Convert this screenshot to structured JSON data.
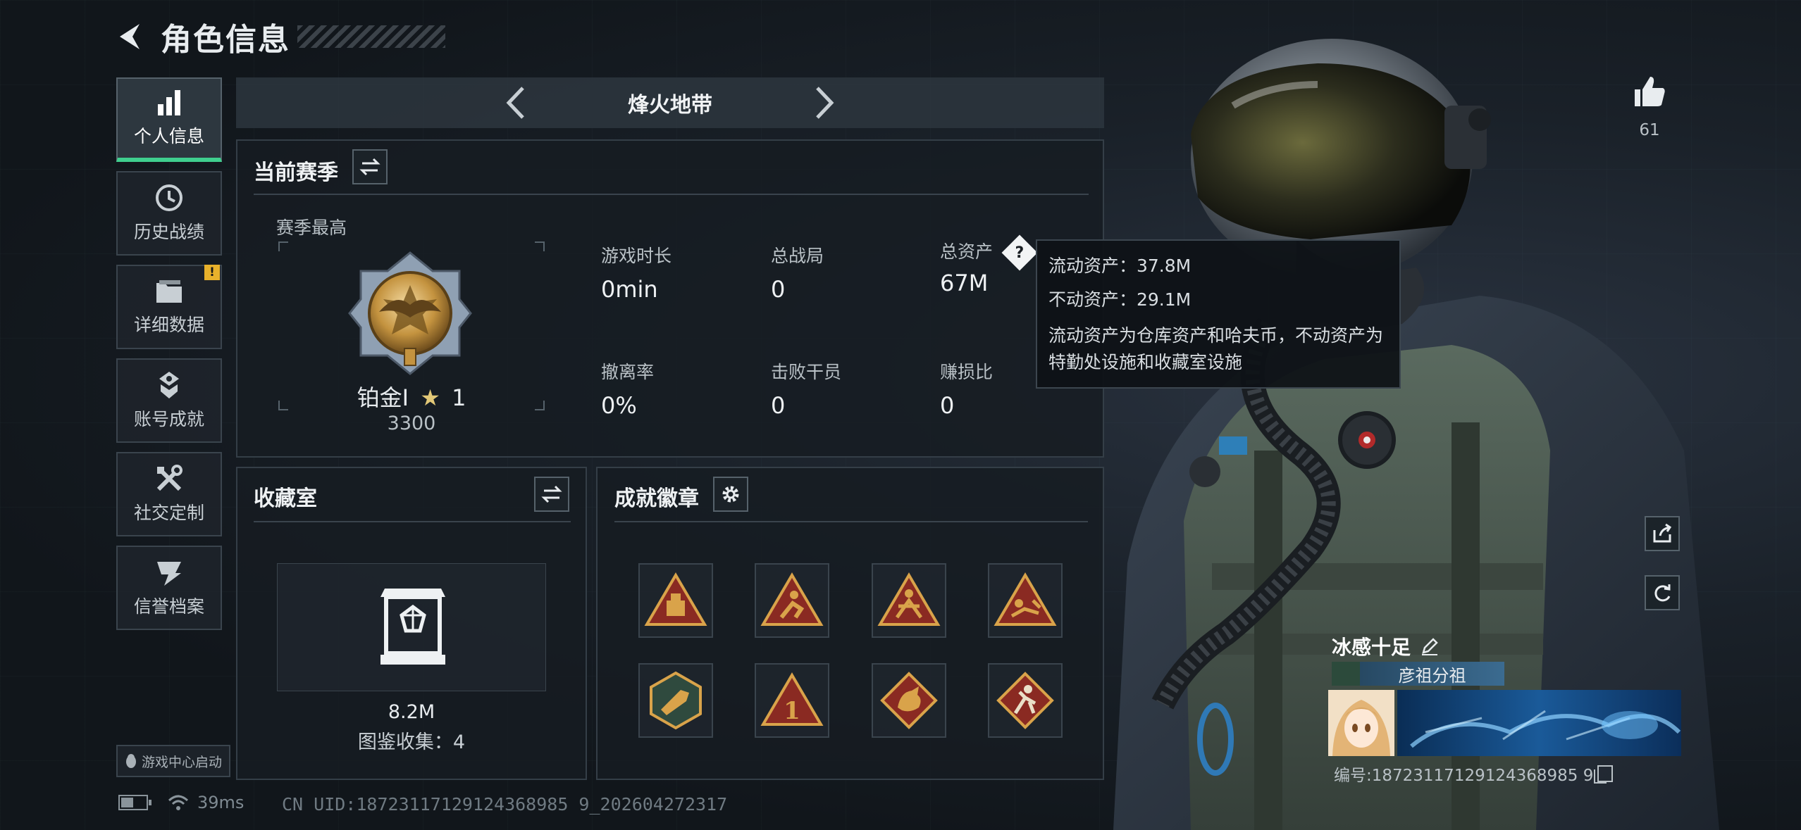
{
  "header": {
    "title": "角色信息"
  },
  "nav": {
    "items": [
      {
        "label": "个人信息",
        "icon": "bar-chart-icon",
        "active": true
      },
      {
        "label": "历史战绩",
        "icon": "history-icon"
      },
      {
        "label": "详细数据",
        "icon": "folder-icon",
        "badge": "!"
      },
      {
        "label": "账号成就",
        "icon": "achievement-icon"
      },
      {
        "label": "社交定制",
        "icon": "tools-icon"
      },
      {
        "label": "信誉档案",
        "icon": "credit-icon"
      }
    ],
    "game_center_label": "游戏中心启动"
  },
  "status": {
    "ping": "39ms",
    "battery_level": 0.5
  },
  "uid": "CN UID:18723117129124368985 9_202604272317",
  "map_selector": {
    "name": "烽火地带"
  },
  "season": {
    "title": "当前赛季",
    "subtitle": "赛季最高",
    "rank": "铂金I",
    "rank_stars": "1",
    "rank_score": "3300",
    "stats": [
      {
        "label": "游戏时长",
        "value": "0min"
      },
      {
        "label": "总战局",
        "value": "0"
      },
      {
        "label": "总资产",
        "value": "67M",
        "help": "?"
      },
      {
        "label": "撤离率",
        "value": "0%"
      },
      {
        "label": "击败干员",
        "value": "0"
      },
      {
        "label": "赚损比",
        "value": "0"
      }
    ]
  },
  "tooltip": {
    "liquid": "流动资产：37.8M",
    "fixed": "不动资产：29.1M",
    "description": "流动资产为仓库资产和哈夫币，不动资产为特勤处设施和收藏室设施"
  },
  "collection": {
    "title": "收藏室",
    "value": "8.2M",
    "count": "图鉴收集：4"
  },
  "badges": {
    "title": "成就徽章",
    "items": [
      {
        "icon": "badge-supply-icon"
      },
      {
        "icon": "badge-runner-icon"
      },
      {
        "icon": "badge-fighter-icon"
      },
      {
        "icon": "badge-crawl-icon"
      },
      {
        "icon": "badge-weapon-icon"
      },
      {
        "icon": "badge-number-one-icon",
        "text": "1"
      },
      {
        "icon": "badge-dragon-icon"
      },
      {
        "icon": "badge-sprint-icon"
      }
    ]
  },
  "profile": {
    "likes": "61",
    "player_name": "冰感十足",
    "team_tag": "彦祖分祖",
    "player_id": "编号:18723117129124368985 9"
  },
  "colors": {
    "accent": "#3fcf8e",
    "warning": "#e8b12b",
    "badge_bg": "#8a2a22",
    "badge_gold": "#d9a34a"
  }
}
